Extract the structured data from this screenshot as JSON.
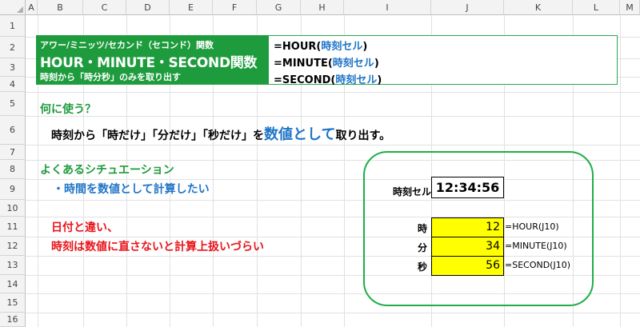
{
  "columns": [
    "A",
    "B",
    "C",
    "D",
    "E",
    "F",
    "G",
    "H",
    "I",
    "J",
    "K",
    "L",
    "M"
  ],
  "rows": [
    "1",
    "2",
    "3",
    "4",
    "5",
    "6",
    "7",
    "8",
    "9",
    "10",
    "11",
    "12",
    "13",
    "14",
    "15",
    "16"
  ],
  "header_box": {
    "line1": "アワー/ミニッツ/セカンド（セコンド）関数",
    "line2": "HOUR・MINUTE・SECOND関数",
    "line3": "時刻から「時分秒」のみを取り出す",
    "formulas": [
      {
        "func": "=HOUR(",
        "arg": "時刻セル",
        "close": ")"
      },
      {
        "func": "=MINUTE(",
        "arg": "時刻セル",
        "close": ")"
      },
      {
        "func": "=SECOND(",
        "arg": "時刻セル",
        "close": ")"
      }
    ]
  },
  "usage": {
    "heading": "何に使う？",
    "sentence_part1": "時刻から「時だけ」「分だけ」「秒だけ」を",
    "sentence_highlight": "数値として",
    "sentence_part2": "取り出す。"
  },
  "situation": {
    "heading": "よくあるシチュエーション",
    "bullet": "・時間を数値として計算したい"
  },
  "warning": {
    "line1": "日付と違い、",
    "line2": "時刻は数値に直さないと計算上扱いづらい"
  },
  "example": {
    "time_label": "時刻セル",
    "time_value": "12:34:56",
    "results": [
      {
        "label": "時",
        "value": "12",
        "formula": "=HOUR(J10)"
      },
      {
        "label": "分",
        "value": "34",
        "formula": "=MINUTE(J10)"
      },
      {
        "label": "秒",
        "value": "56",
        "formula": "=SECOND(J10)"
      }
    ]
  },
  "colors": {
    "green": "#1e9c3d",
    "blue": "#1f74c8",
    "red": "#e8141a",
    "yellow": "#ffff00"
  }
}
